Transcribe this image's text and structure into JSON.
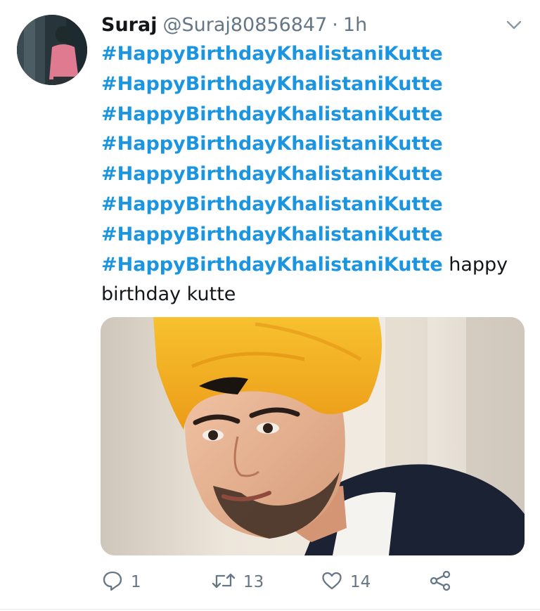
{
  "tweet": {
    "author_name": "Suraj",
    "author_handle": "@Suraj80856847",
    "separator": "·",
    "timestamp": "1h",
    "hashtags": [
      "#HappyBirthdayKhalistaniKutte",
      "#HappyBirthdayKhalistaniKutte",
      "#HappyBirthdayKhalistaniKutte",
      "#HappyBirthdayKhalistaniKutte",
      "#HappyBirthdayKhalistaniKutte",
      "#HappyBirthdayKhalistaniKutte",
      "#HappyBirthdayKhalistaniKutte",
      "#HappyBirthdayKhalistaniKutte"
    ],
    "trailing_text": " happy birthday kutte"
  },
  "actions": {
    "reply_count": "1",
    "retweet_count": "13",
    "like_count": "14"
  },
  "icons": {
    "caret": "chevron-down-icon",
    "reply": "reply-icon",
    "retweet": "retweet-icon",
    "like": "heart-icon",
    "share": "share-icon"
  },
  "colors": {
    "hashtag": "#1b95e0",
    "name": "#14171a",
    "muted": "#657786",
    "turban": "#f4b225"
  }
}
